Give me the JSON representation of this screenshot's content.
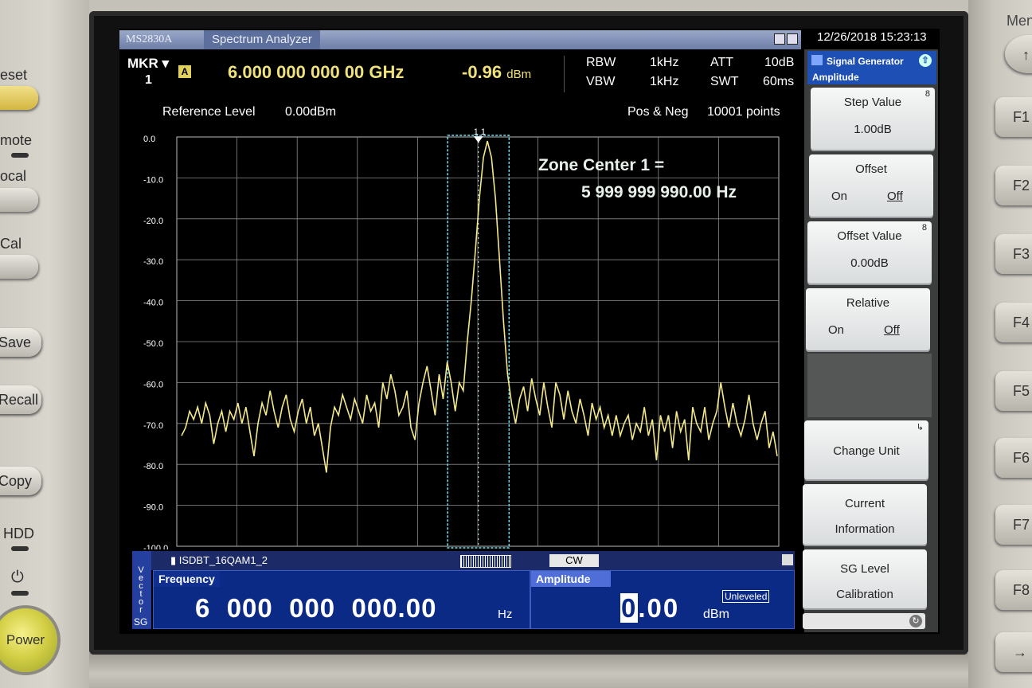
{
  "instrument": {
    "model": "MS2830A",
    "app_name": "Spectrum Analyzer",
    "datetime": "12/26/2018 15:23:13"
  },
  "hardware": {
    "left_labels": [
      "eset",
      "mote",
      "ocal",
      "Cal"
    ],
    "left_buttons": [
      "Save",
      "Recall",
      "Copy"
    ],
    "hdd_label": "HDD",
    "power_label": "Power",
    "menu_label": "Men",
    "f_keys": [
      "F1",
      "F2",
      "F3",
      "F4",
      "F5",
      "F6",
      "F7",
      "F8",
      "→"
    ]
  },
  "marker": {
    "label": "MKR",
    "number": "1",
    "badge": "A",
    "frequency": "6.000 000 000 00 GHz",
    "level": "-0.96",
    "level_unit": "dBm"
  },
  "params": {
    "rbw_label": "RBW",
    "rbw": "1kHz",
    "vbw_label": "VBW",
    "vbw": "1kHz",
    "att_label": "ATT",
    "att": "10dB",
    "swt_label": "SWT",
    "swt": "60ms"
  },
  "measurement": {
    "ref_level_label": "Reference Level",
    "ref_level": "0.00dBm",
    "detector": "Pos & Neg",
    "points": "10001 points"
  },
  "plot": {
    "y_ticks": [
      "0.0",
      "-10.0",
      "-20.0",
      "-30.0",
      "-40.0",
      "-50.0",
      "-60.0",
      "-70.0",
      "-80.0",
      "-90.0",
      "-100.0"
    ],
    "ylim": [
      -100,
      0
    ],
    "trace_color": "#f3e98a",
    "zone_color": "#6fe0f0",
    "marker_label": "1 1",
    "zone_line1": "Zone Center 1 =",
    "zone_line2": "5 999 999 990.00 Hz",
    "trace_db": [
      -73,
      -71,
      -67,
      -69,
      -66,
      -70,
      -65,
      -68,
      -75,
      -70,
      -67,
      -72,
      -67,
      -69,
      -65,
      -70,
      -66,
      -72,
      -78,
      -70,
      -65,
      -68,
      -62,
      -67,
      -71,
      -66,
      -63,
      -69,
      -72,
      -67,
      -64,
      -70,
      -66,
      -73,
      -70,
      -76,
      -82,
      -71,
      -66,
      -68,
      -63,
      -66,
      -69,
      -64,
      -67,
      -70,
      -63,
      -67,
      -65,
      -71,
      -60,
      -64,
      -58,
      -62,
      -68,
      -66,
      -62,
      -71,
      -74,
      -65,
      -60,
      -56,
      -62,
      -68,
      -58,
      -64,
      -55,
      -60,
      -67,
      -60,
      -62,
      -50,
      -40,
      -28,
      -15,
      -5,
      -1,
      -5,
      -15,
      -30,
      -45,
      -58,
      -65,
      -70,
      -64,
      -61,
      -67,
      -59,
      -64,
      -68,
      -60,
      -66,
      -71,
      -60,
      -63,
      -69,
      -62,
      -67,
      -70,
      -64,
      -68,
      -73,
      -65,
      -69,
      -66,
      -71,
      -68,
      -73,
      -68,
      -73,
      -70,
      -68,
      -74,
      -70,
      -72,
      -66,
      -73,
      -69,
      -79,
      -68,
      -72,
      -68,
      -76,
      -67,
      -72,
      -69,
      -79,
      -66,
      -70,
      -72,
      -66,
      -74,
      -70,
      -67,
      -60,
      -66,
      -71,
      -65,
      -70,
      -73,
      -69,
      -63,
      -70,
      -74,
      -70,
      -67,
      -76,
      -72,
      -78
    ]
  },
  "sg": {
    "badge_letters": "Vector",
    "badge_sg": "SG",
    "pattern": "ISDBT_16QAM1_2",
    "mode": "CW",
    "frequency_title": "Frequency",
    "frequency_value": "6  000  000  000.00",
    "frequency_unit": "Hz",
    "amplitude_title": "Amplitude",
    "amplitude_cursor_digit": "0",
    "amplitude_rest": ".00",
    "amplitude_unit": "dBm",
    "unleveled": "Unleveled"
  },
  "menu": {
    "header_title": "Signal Generator",
    "header_sub": "Amplitude",
    "step_value_label": "Step Value",
    "step_value": "1.00dB",
    "offset_label": "Offset",
    "offset_on": "On",
    "offset_off": "Off",
    "offset_value_label": "Offset Value",
    "offset_value": "0.00dB",
    "relative_label": "Relative",
    "relative_on": "On",
    "relative_off": "Off",
    "change_unit_label": "Change Unit",
    "current_info_line1": "Current",
    "current_info_line2": "Information",
    "sg_level_line1": "SG Level",
    "sg_level_line2": "Calibration"
  }
}
